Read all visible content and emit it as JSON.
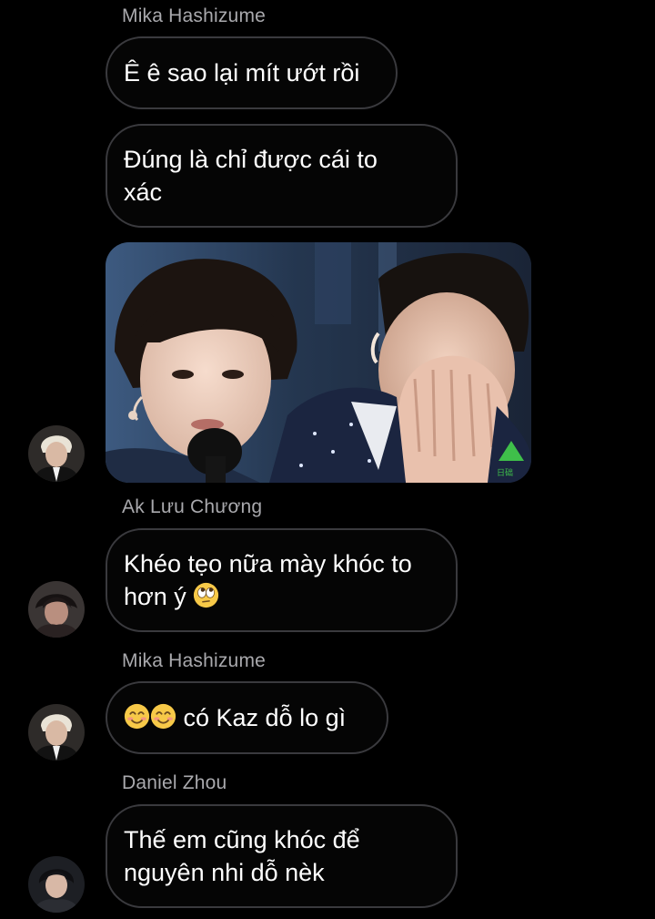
{
  "messages": [
    {
      "type": "sender",
      "name": "Mika Hashizume"
    },
    {
      "type": "text",
      "text": "Ê ê sao lại mít ướt rồi"
    },
    {
      "type": "text",
      "text": "Đúng là chỉ được cái to xác",
      "lines": [
        "Đúng là chỉ được cái to",
        "xác"
      ]
    },
    {
      "type": "image",
      "subject": "photo-two-performers-one-crying",
      "watermark": "日础"
    },
    {
      "type": "sender",
      "name": "Ak Lưu Chương"
    },
    {
      "type": "text",
      "lines": [
        "Khéo tẹo nữa mày khóc to",
        "hơn ý"
      ],
      "emoji": [
        "face-with-rolling-eyes"
      ]
    },
    {
      "type": "sender",
      "name": "Mika Hashizume"
    },
    {
      "type": "text",
      "text": "có Kaz dỗ lo gì",
      "emoji": [
        "smiling-face-with-smiling-eyes",
        "smiling-face-with-smiling-eyes"
      ]
    },
    {
      "type": "sender",
      "name": "Daniel Zhou"
    },
    {
      "type": "text",
      "lines": [
        "Thế em cũng khóc để",
        "nguyên nhi dỗ nèk"
      ]
    }
  ],
  "colors": {
    "background": "#000000",
    "bubble_border": "#3a3a3e",
    "sender_text": "#a9a9ad",
    "message_text": "#ffffff"
  }
}
